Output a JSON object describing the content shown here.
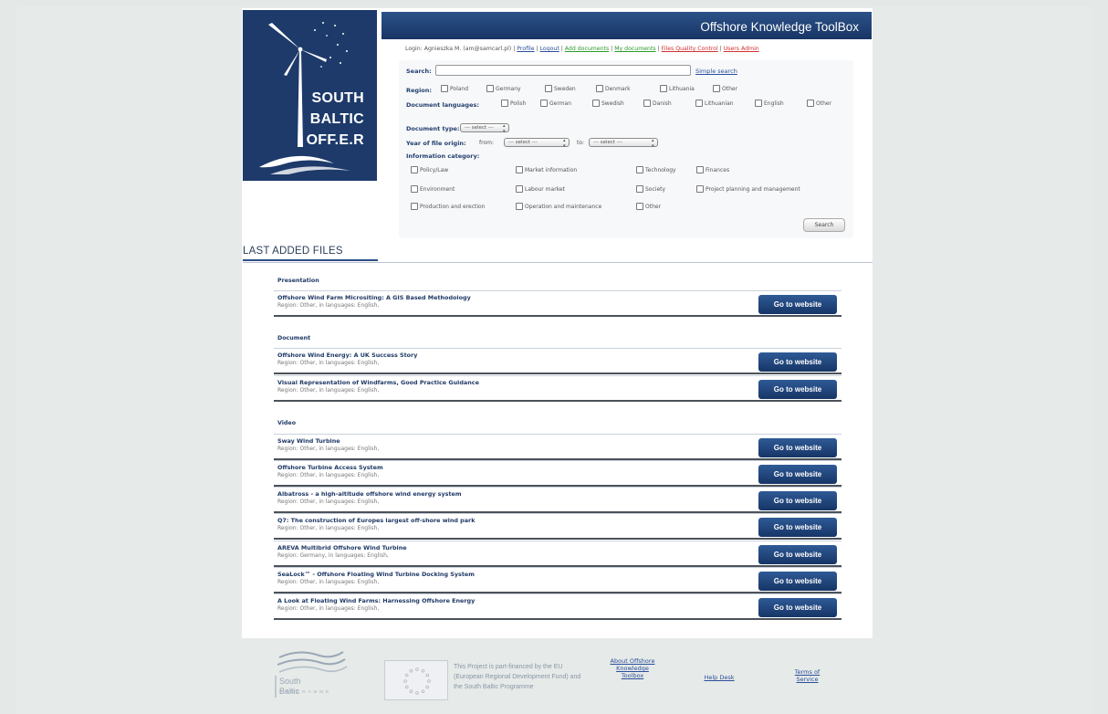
{
  "header": {
    "title": "Offshore Knowledge ToolBox"
  },
  "logo": {
    "line1": "SOUTH",
    "line2": "BALTIC",
    "line3": "OFF.E.R"
  },
  "userbar": {
    "login": "Login: Agnieszka M. (am@samcarl.pl) | ",
    "profile": "Profile",
    "logout": "Logout",
    "add_documents": "Add documents",
    "my_documents": "My documents",
    "files_quality": "Files Quality Control",
    "users_admin": "Users Admin",
    "sep": " | "
  },
  "search": {
    "label": "Search:",
    "simple_link": "Simple search",
    "input_value": "",
    "region_label": "Region:",
    "regions": [
      "Poland",
      "Germany",
      "Sweden",
      "Denmark",
      "Lithuania",
      "Other"
    ],
    "lang_label": "Document languages:",
    "languages": [
      "Polish",
      "German",
      "Swedish",
      "Danish",
      "Lithuanian",
      "English",
      "Other"
    ],
    "doctype_label": "Document type:",
    "doctype_value": "--- select ---",
    "year_label": "Year of file origin:",
    "year_from": "from:",
    "year_from_value": "--- select ---",
    "year_to": "to:",
    "year_to_value": "--- select ---",
    "info_label": "Information category:",
    "categories": [
      "Policy/Law",
      "Market information",
      "Technology",
      "Finances",
      "Environment",
      "Labour market",
      "Society",
      "Project planning and management",
      "Production and erection",
      "Operation and maintenance",
      "Other"
    ],
    "button": "Search"
  },
  "last_added": {
    "title": "LAST ADDED FILES",
    "button_label": "Go to website",
    "groups": [
      {
        "name": "Presentation",
        "items": [
          {
            "title": "Offshore Wind Farm Micrositing: A GIS Based Methodology",
            "sub": "Region: Other, in languages: English,"
          }
        ]
      },
      {
        "name": "Document",
        "items": [
          {
            "title": "Offshore Wind Energy: A UK Success Story",
            "sub": "Region: Other, in languages: English,"
          },
          {
            "title": "Visual Representation of Windfarms, Good Practice Guidance",
            "sub": "Region: Other, in languages: English,"
          }
        ]
      },
      {
        "name": "Video",
        "items": [
          {
            "title": "Sway Wind Turbine",
            "sub": "Region: Other, in languages: English,"
          },
          {
            "title": "Offshore Turbine Access System",
            "sub": "Region: Other, in languages: English,"
          },
          {
            "title": "Albatross - a high-altitude offshore wind energy system",
            "sub": "Region: Other, in languages: English,"
          },
          {
            "title": "Q7: The construction of Europes largest off-shore wind park",
            "sub": "Region: Other, in languages: English,"
          },
          {
            "title": "AREVA Multibrid Offshore Wind Turbine",
            "sub": "Region: Germany, in languages: English,"
          },
          {
            "title": "SeaLock™ - Offshore Floating Wind Turbine Docking System",
            "sub": "Region: Other, in languages: English,"
          },
          {
            "title": "A Look at Floating Wind Farms: Harnessing Offshore Energy",
            "sub": "Region: Other, in languages: English,"
          }
        ]
      }
    ]
  },
  "footer": {
    "sb_logo_text": "South Baltic",
    "sb_logo_sub": "PROGRAMME",
    "funding_text": "This Project is part-financed by the EU (European Regional Development Fund) and the South Baltic Programme",
    "about_link": "About Offshore Knowledge Toolbox",
    "help_link": "Help Desk",
    "terms_link": "Terms of Service"
  },
  "colors": {
    "brand_navy": "#1d3a6a",
    "button_blue": "#234a82",
    "background": "#e4e8e6"
  }
}
